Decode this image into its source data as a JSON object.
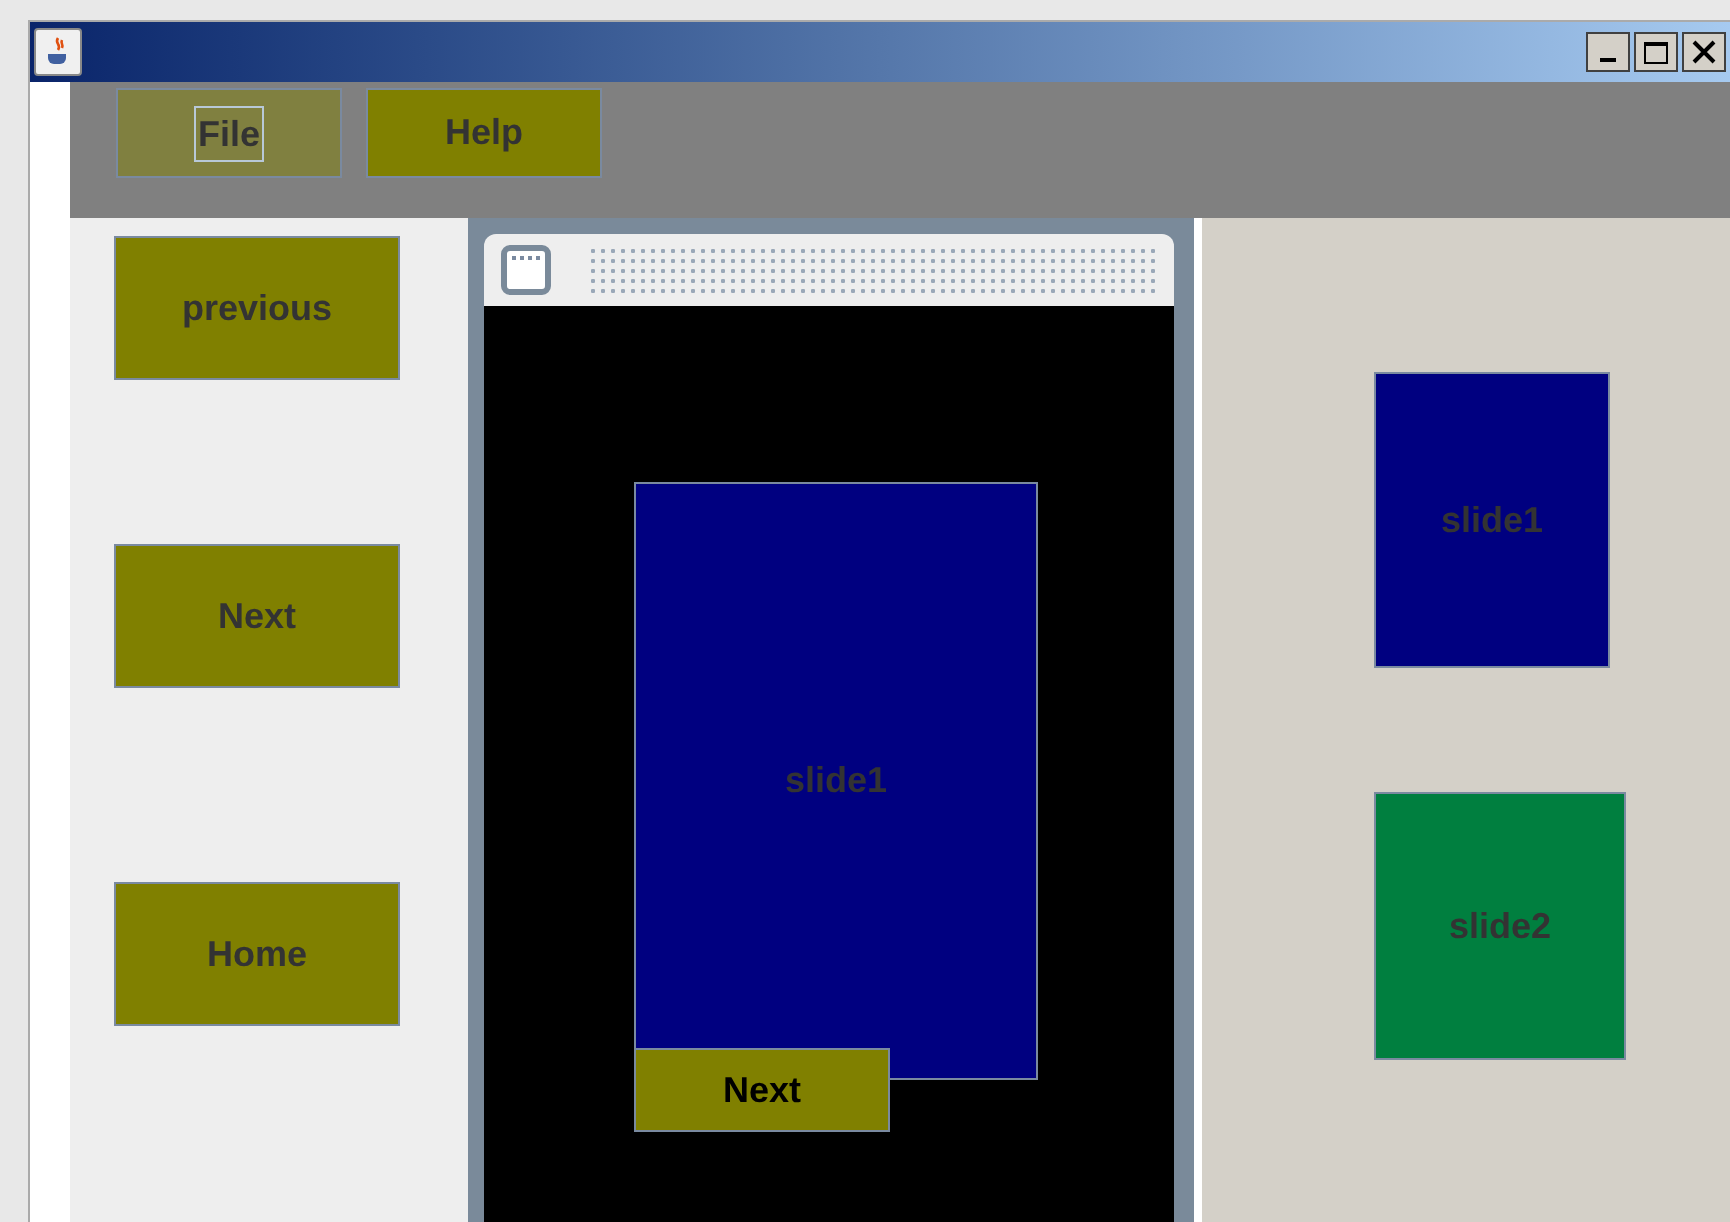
{
  "menu": [
    {
      "label": "File",
      "focused": true
    },
    {
      "label": "Help",
      "focused": false
    }
  ],
  "nav_buttons": [
    "previous",
    "Next",
    "Home"
  ],
  "canvas": {
    "slide": "slide1",
    "button": "Next"
  },
  "thumbnails": [
    {
      "label": "slide1",
      "color": "#000080"
    },
    {
      "label": "slide2",
      "color": "#007f3f"
    }
  ]
}
